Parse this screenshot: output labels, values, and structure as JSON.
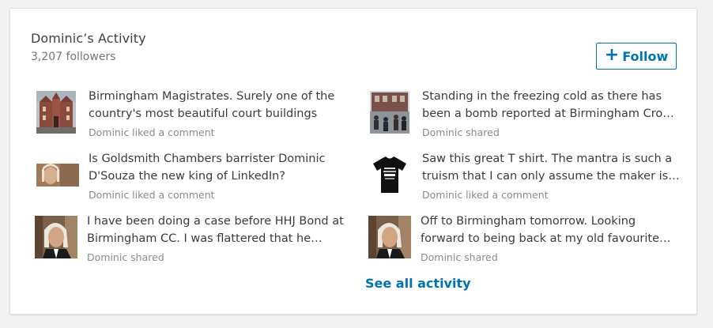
{
  "card": {
    "title": "Dominic’s Activity",
    "followers": "3,207 followers",
    "follow_button": {
      "icon": "+",
      "label": "Follow"
    },
    "see_all": "See all activity"
  },
  "colors": {
    "accent": "#0073b1",
    "text": "#3b3b3b",
    "meta": "#8a8a8a"
  },
  "activities": [
    {
      "text": "Birmingham Magistrates. Surely one of the country's most beautiful court buildings",
      "meta": "Dominic liked a comment",
      "thumb": "court-building-image"
    },
    {
      "text": "Standing in the freezing cold as there has been a bomb reported at Birmingham Crown Court",
      "meta": "Dominic shared",
      "thumb": "crowd-outside-court-image"
    },
    {
      "text": "Is Goldsmith Chambers barrister Dominic D'Souza the new king of LinkedIn?",
      "meta": "Dominic liked a comment",
      "thumb": "barrister-wig-image"
    },
    {
      "text": "Saw this great T shirt. The mantra is such a truism that I can only assume the maker is a…",
      "meta": "Dominic liked a comment",
      "thumb": "black-tshirt-image"
    },
    {
      "text": "I have been doing a case before HHJ Bond at Birmingham CC. I was flattered that he…",
      "meta": "Dominic shared",
      "thumb": "barrister-portrait-image"
    },
    {
      "text": "Off to Birmingham tomorrow. Looking forward to being back at my old favourite court",
      "meta": "Dominic shared",
      "thumb": "barrister-portrait-image"
    }
  ]
}
